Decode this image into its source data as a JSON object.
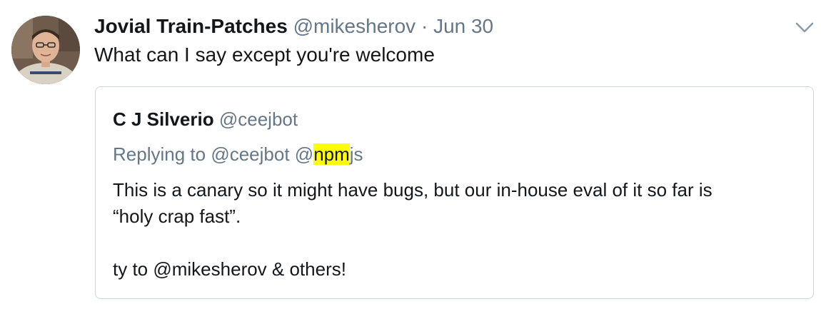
{
  "tweet": {
    "author_name": "Jovial Train-Patches",
    "author_handle": "@mikesherov",
    "separator": "·",
    "date": "Jun 30",
    "text": "What can I say except you're welcome",
    "icons": {
      "avatar": "user-avatar",
      "menu": "chevron-down-icon"
    }
  },
  "quoted_tweet": {
    "author_name": "C J Silverio",
    "author_handle": "@ceejbot",
    "replying_label": "Replying to",
    "reply_mention_1": "@ceejbot",
    "reply_mention_2_prefix": "@",
    "reply_mention_2_highlight": "npm",
    "reply_mention_2_suffix": "js",
    "body_line_1": "This is a canary so it might have bugs, but our in-house eval of it so far is",
    "body_line_2": "“holy crap fast”.",
    "body_line_3": "ty to @mikesherov & others!"
  },
  "colors": {
    "text_primary": "#14171a",
    "text_secondary": "#657786",
    "border": "#ccd6dd",
    "highlight": "#ffff00"
  }
}
